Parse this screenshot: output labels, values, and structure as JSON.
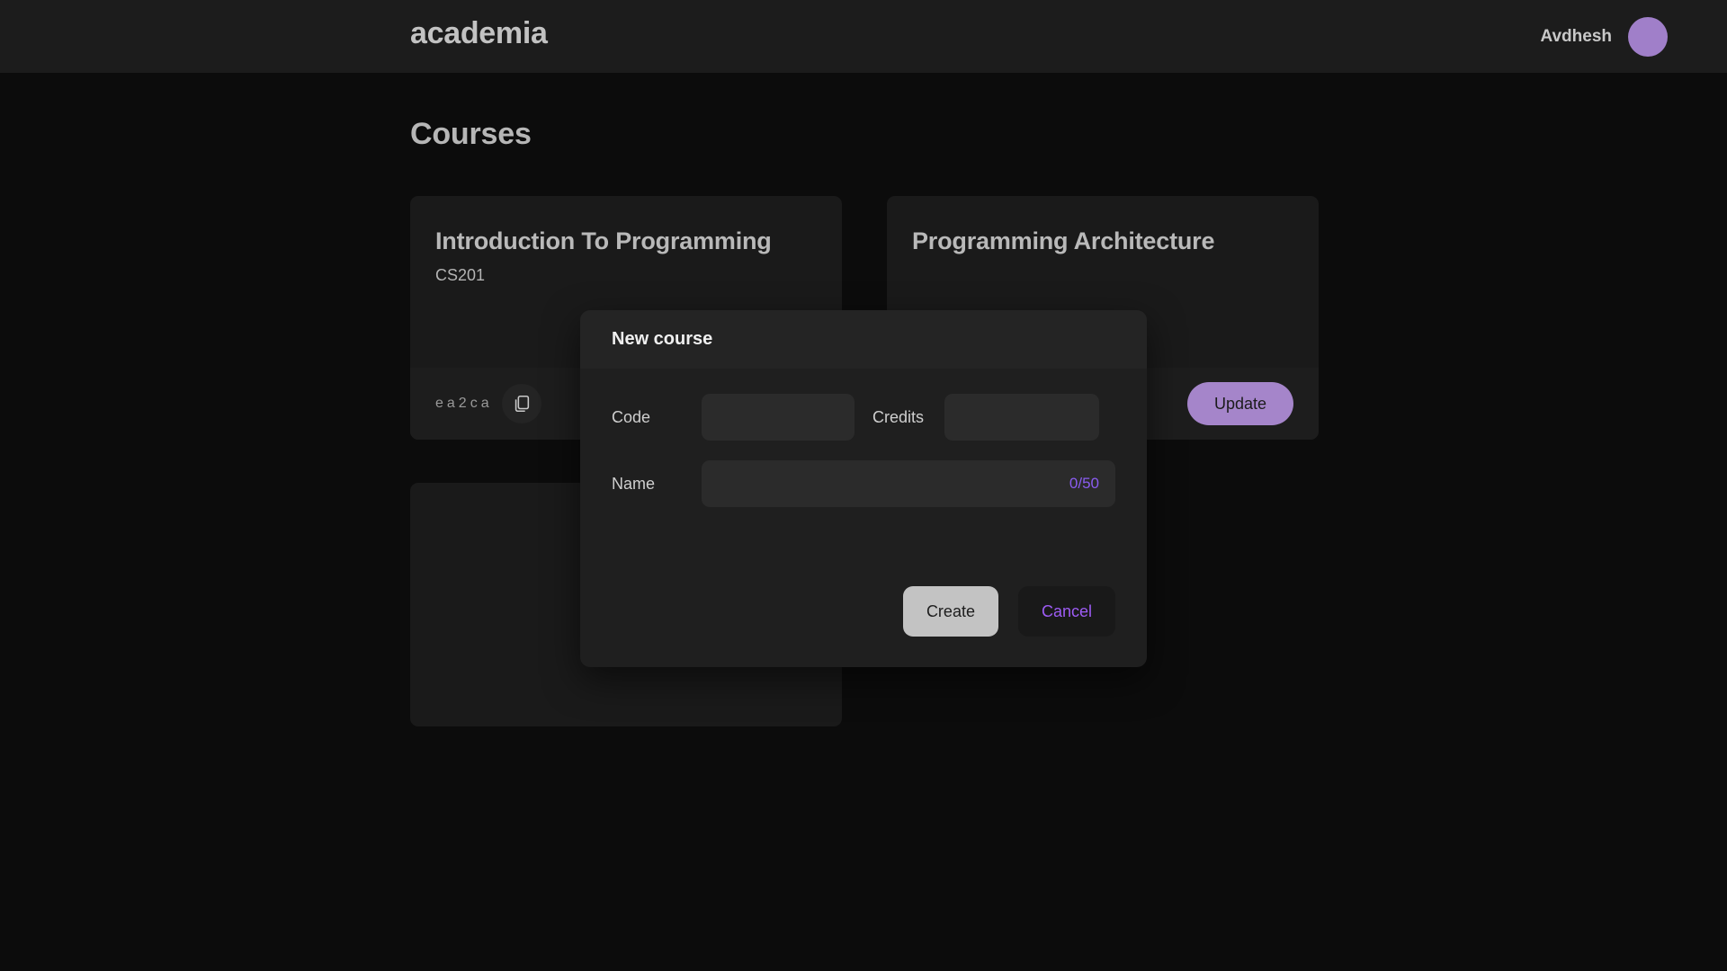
{
  "header": {
    "logo": "academia",
    "user_name": "Avdhesh",
    "avatar_color": "#a07fc9",
    "avatar_icon": "user-avatar"
  },
  "page": {
    "title": "Courses"
  },
  "courses": [
    {
      "title": "Introduction To Programming",
      "code": "CS201",
      "id_fragment": "ea2ca",
      "copy_icon": "copy-icon",
      "action_label": "",
      "empty": false,
      "has_action": false
    },
    {
      "title": "Programming Architecture",
      "code": "",
      "id_fragment": "",
      "copy_icon": "copy-icon",
      "action_label": "Update",
      "empty": false,
      "has_action": true
    },
    {
      "title": "",
      "code": "",
      "id_fragment": "",
      "copy_icon": "",
      "action_label": "",
      "empty": true,
      "has_action": false
    }
  ],
  "modal": {
    "title": "New course",
    "fields": {
      "code_label": "Code",
      "code_value": "",
      "code_placeholder": "",
      "credits_label": "Credits",
      "credits_value": "",
      "credits_placeholder": "",
      "name_label": "Name",
      "name_value": "",
      "name_placeholder": "",
      "name_counter": "0/50",
      "counter_color": "#8a5cf0"
    },
    "buttons": {
      "create_label": "Create",
      "cancel_label": "Cancel"
    }
  },
  "colors": {
    "page_bg": "#0c0c0c",
    "header_bg": "#1c1c1c",
    "card_bg": "#1a1a1a",
    "modal_bg": "#1f1f1f",
    "accent_purple": "#a585ca",
    "link_purple": "#9e5cf5"
  }
}
